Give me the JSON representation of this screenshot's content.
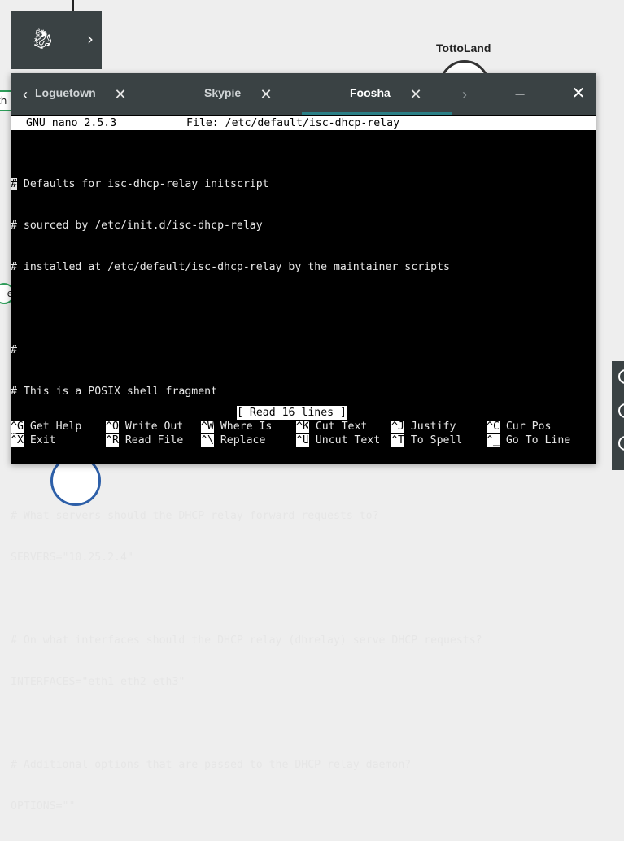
{
  "background": {
    "dock": {
      "logo_icon": "dragon-logo-icon",
      "expand_icon": "chevron-right-icon"
    },
    "node_label": "TottoLand",
    "edge_tag_1": "th",
    "edge_tag_2": "e"
  },
  "tabs": [
    {
      "label": "Loguetown",
      "active": false
    },
    {
      "label": "Skypie",
      "active": false
    },
    {
      "label": "Foosha",
      "active": true
    }
  ],
  "window_controls": {
    "minimize": "–",
    "close": "✕"
  },
  "nano": {
    "version": "GNU nano 2.5.3",
    "file": "File: /etc/default/isc-dhcp-relay",
    "lines": [
      "# Defaults for isc-dhcp-relay initscript",
      "# sourced by /etc/init.d/isc-dhcp-relay",
      "# installed at /etc/default/isc-dhcp-relay by the maintainer scripts",
      "",
      "#",
      "# This is a POSIX shell fragment",
      "#",
      "",
      "# What servers should the DHCP relay forward requests to?",
      "SERVERS=\"10.25.2.4\"",
      "",
      "# On what interfaces should the DHCP relay (dhrelay) serve DHCP requests?",
      "INTERFACES=\"eth1 eth2 eth3\"",
      "",
      "# Additional options that are passed to the DHCP relay daemon?",
      "OPTIONS=\"\""
    ],
    "status": "[ Read 16 lines ]",
    "shortcuts": [
      {
        "key": "^G",
        "label": "Get Help"
      },
      {
        "key": "^O",
        "label": "Write Out"
      },
      {
        "key": "^W",
        "label": "Where Is"
      },
      {
        "key": "^K",
        "label": "Cut Text"
      },
      {
        "key": "^J",
        "label": "Justify"
      },
      {
        "key": "^C",
        "label": "Cur Pos"
      },
      {
        "key": "^X",
        "label": "Exit"
      },
      {
        "key": "^R",
        "label": "Read File"
      },
      {
        "key": "^\\",
        "label": "Replace"
      },
      {
        "key": "^U",
        "label": "Uncut Text"
      },
      {
        "key": "^T",
        "label": "To Spell"
      },
      {
        "key": "^_",
        "label": "Go To Line"
      }
    ]
  },
  "colors": {
    "accent": "#2a7f86",
    "tab_bg": "#3a4244",
    "link_green": "#2e9e5a"
  }
}
